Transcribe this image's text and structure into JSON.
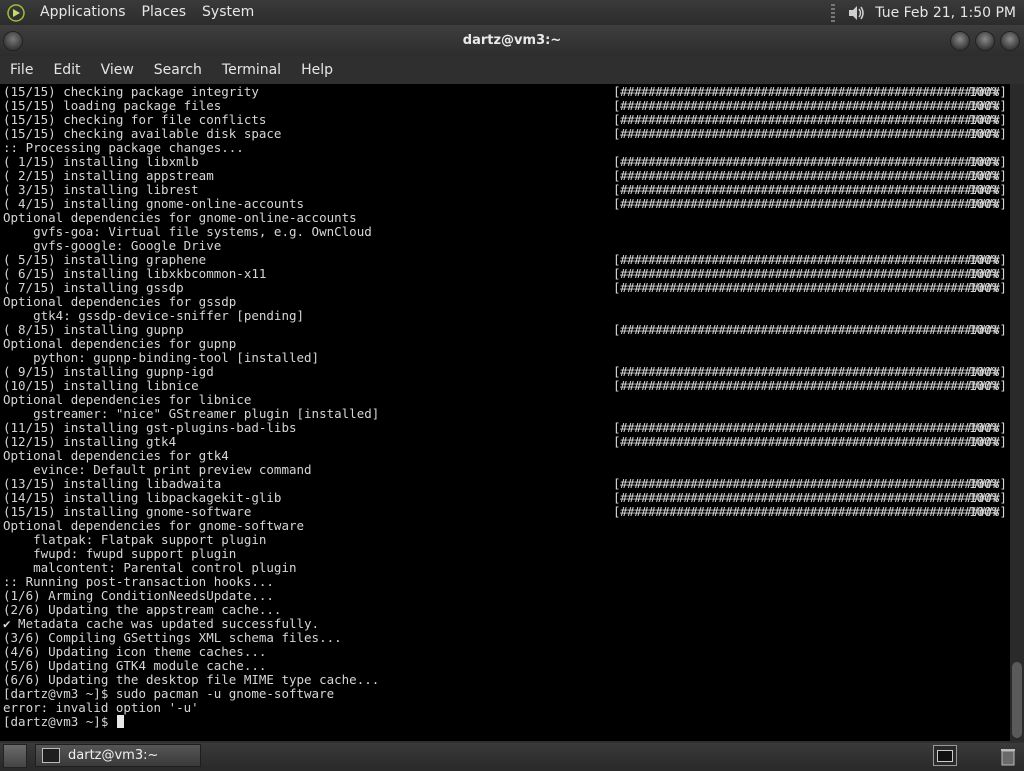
{
  "top_panel": {
    "menu": [
      "Applications",
      "Places",
      "System"
    ],
    "clock": "Tue Feb 21, 1:50 PM"
  },
  "window": {
    "title": "dartz@vm3:~",
    "menubar": [
      "File",
      "Edit",
      "View",
      "Search",
      "Terminal",
      "Help"
    ]
  },
  "terminal": {
    "lines": [
      {
        "text": "(15/15) checking package integrity",
        "bar": "[######################################################] 100%"
      },
      {
        "text": "(15/15) loading package files",
        "bar": "[######################################################] 100%"
      },
      {
        "text": "(15/15) checking for file conflicts",
        "bar": "[######################################################] 100%"
      },
      {
        "text": "(15/15) checking available disk space",
        "bar": "[######################################################] 100%"
      },
      {
        "text": ":: Processing package changes...",
        "bar": ""
      },
      {
        "text": "( 1/15) installing libxmlb",
        "bar": "[######################################################] 100%"
      },
      {
        "text": "( 2/15) installing appstream",
        "bar": "[######################################################] 100%"
      },
      {
        "text": "( 3/15) installing librest",
        "bar": "[######################################################] 100%"
      },
      {
        "text": "( 4/15) installing gnome-online-accounts",
        "bar": "[######################################################] 100%"
      },
      {
        "text": "Optional dependencies for gnome-online-accounts",
        "bar": ""
      },
      {
        "text": "    gvfs-goa: Virtual file systems, e.g. OwnCloud",
        "bar": ""
      },
      {
        "text": "    gvfs-google: Google Drive",
        "bar": ""
      },
      {
        "text": "( 5/15) installing graphene",
        "bar": "[######################################################] 100%"
      },
      {
        "text": "( 6/15) installing libxkbcommon-x11",
        "bar": "[######################################################] 100%"
      },
      {
        "text": "( 7/15) installing gssdp",
        "bar": "[######################################################] 100%"
      },
      {
        "text": "Optional dependencies for gssdp",
        "bar": ""
      },
      {
        "text": "    gtk4: gssdp-device-sniffer [pending]",
        "bar": ""
      },
      {
        "text": "( 8/15) installing gupnp",
        "bar": "[######################################################] 100%"
      },
      {
        "text": "Optional dependencies for gupnp",
        "bar": ""
      },
      {
        "text": "    python: gupnp-binding-tool [installed]",
        "bar": ""
      },
      {
        "text": "( 9/15) installing gupnp-igd",
        "bar": "[######################################################] 100%"
      },
      {
        "text": "(10/15) installing libnice",
        "bar": "[######################################################] 100%"
      },
      {
        "text": "Optional dependencies for libnice",
        "bar": ""
      },
      {
        "text": "    gstreamer: \"nice\" GStreamer plugin [installed]",
        "bar": ""
      },
      {
        "text": "(11/15) installing gst-plugins-bad-libs",
        "bar": "[######################################################] 100%"
      },
      {
        "text": "(12/15) installing gtk4",
        "bar": "[######################################################] 100%"
      },
      {
        "text": "Optional dependencies for gtk4",
        "bar": ""
      },
      {
        "text": "    evince: Default print preview command",
        "bar": ""
      },
      {
        "text": "(13/15) installing libadwaita",
        "bar": "[######################################################] 100%"
      },
      {
        "text": "(14/15) installing libpackagekit-glib",
        "bar": "[######################################################] 100%"
      },
      {
        "text": "(15/15) installing gnome-software",
        "bar": "[######################################################] 100%"
      },
      {
        "text": "Optional dependencies for gnome-software",
        "bar": ""
      },
      {
        "text": "    flatpak: Flatpak support plugin",
        "bar": ""
      },
      {
        "text": "    fwupd: fwupd support plugin",
        "bar": ""
      },
      {
        "text": "    malcontent: Parental control plugin",
        "bar": ""
      },
      {
        "text": ":: Running post-transaction hooks...",
        "bar": ""
      },
      {
        "text": "(1/6) Arming ConditionNeedsUpdate...",
        "bar": ""
      },
      {
        "text": "(2/6) Updating the appstream cache...",
        "bar": ""
      },
      {
        "text": "✔ Metadata cache was updated successfully.",
        "bar": ""
      },
      {
        "text": "(3/6) Compiling GSettings XML schema files...",
        "bar": ""
      },
      {
        "text": "(4/6) Updating icon theme caches...",
        "bar": ""
      },
      {
        "text": "(5/6) Updating GTK4 module cache...",
        "bar": ""
      },
      {
        "text": "(6/6) Updating the desktop file MIME type cache...",
        "bar": ""
      },
      {
        "text": "[dartz@vm3 ~]$ sudo pacman -u gnome-software",
        "bar": ""
      },
      {
        "text": "error: invalid option '-u'",
        "bar": ""
      }
    ],
    "prompt": "[dartz@vm3 ~]$ "
  },
  "taskbar": {
    "task_label": "dartz@vm3:~"
  },
  "colors": {
    "terminal_bg": "#000000",
    "terminal_fg": "#d6d6d6",
    "panel_bg": "#2f2f2f"
  }
}
